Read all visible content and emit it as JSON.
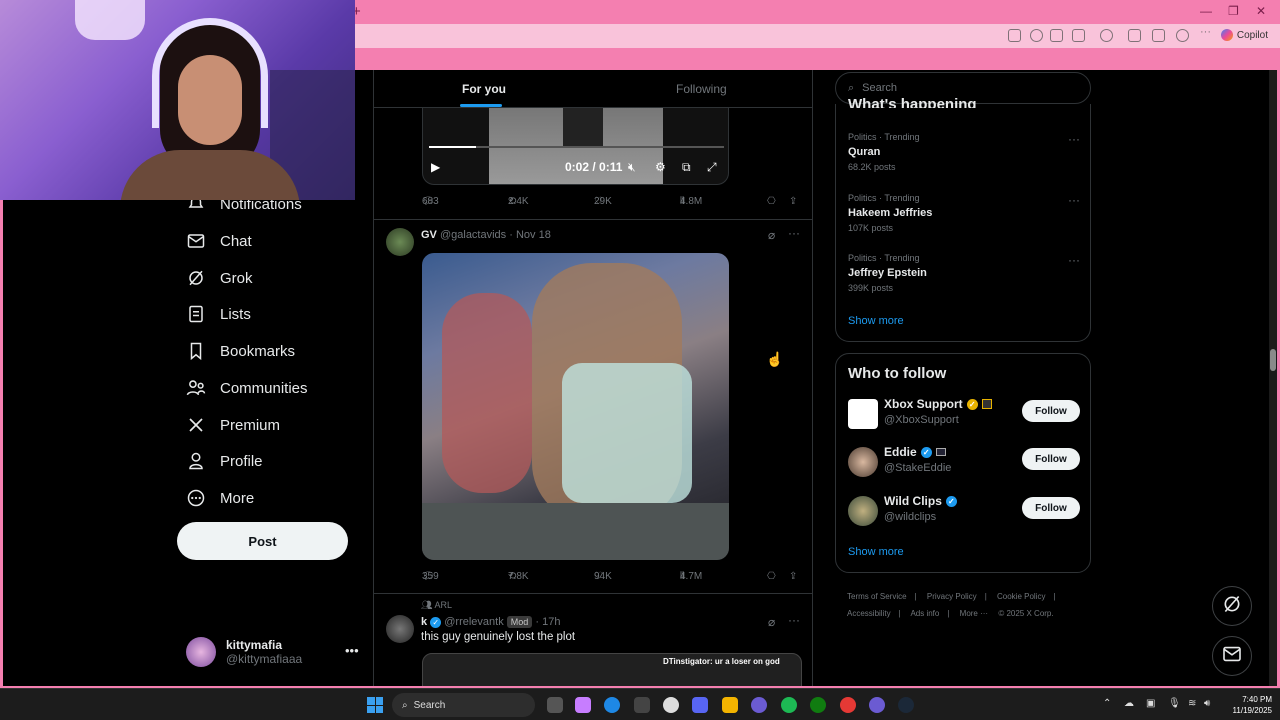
{
  "browser": {
    "new_tab": "+",
    "copilot_label": "Copilot",
    "window_controls": [
      "—",
      "❐",
      "✕"
    ]
  },
  "nav": {
    "items": [
      {
        "label": "Notifications",
        "icon": "bell-icon"
      },
      {
        "label": "Chat",
        "icon": "mail-icon"
      },
      {
        "label": "Grok",
        "icon": "grok-icon"
      },
      {
        "label": "Lists",
        "icon": "list-icon"
      },
      {
        "label": "Bookmarks",
        "icon": "bookmark-icon"
      },
      {
        "label": "Communities",
        "icon": "people-icon"
      },
      {
        "label": "Premium",
        "icon": "x-logo-icon"
      },
      {
        "label": "Profile",
        "icon": "person-icon"
      },
      {
        "label": "More",
        "icon": "more-circle-icon"
      }
    ],
    "post_label": "Post",
    "account": {
      "name": "kittymafia",
      "handle": "@kittymafiaaa"
    }
  },
  "feed": {
    "tabs": {
      "for_you": "For you",
      "following": "Following"
    },
    "video1": {
      "time": "0:02 / 0:11",
      "progress": 0.16
    },
    "tweet1_actions": {
      "replies": "683",
      "reposts": "2.4K",
      "likes": "29K",
      "views": "4.8M"
    },
    "tweet2": {
      "name": "GV",
      "handle": "@galactavids",
      "date": "· Nov 18"
    },
    "tweet2_actions": {
      "replies": "359",
      "reposts": "7.8K",
      "likes": "94K",
      "views": "4.7M"
    },
    "tweet3": {
      "community": "ARL",
      "name": "k",
      "handle": "@rrelevantk",
      "badge": "Mod",
      "date": "· 17h",
      "text": "this guy genuinely lost the plot",
      "media_caption": "DTinstigator: ur a loser on god"
    }
  },
  "sidebar": {
    "search_placeholder": "Search",
    "trends_heading": "What's happening",
    "trends": [
      {
        "category": "Politics · Trending",
        "name": "Quran",
        "count": "68.2K posts"
      },
      {
        "category": "Politics · Trending",
        "name": "Hakeem Jeffries",
        "count": "107K posts"
      },
      {
        "category": "Politics · Trending",
        "name": "Jeffrey Epstein",
        "count": "399K posts"
      }
    ],
    "show_more": "Show more",
    "who_title": "Who to follow",
    "follow": [
      {
        "name": "Xbox Support",
        "handle": "@XboxSupport",
        "button": "Follow",
        "badge_color": "#e8b300"
      },
      {
        "name": "Eddie",
        "handle": "@StakeEddie",
        "button": "Follow",
        "badge_color": "#1d9bf0"
      },
      {
        "name": "Wild Clips",
        "handle": "@wildclips",
        "button": "Follow",
        "badge_color": "#1d9bf0"
      }
    ],
    "show_more_2": "Show more",
    "footer": [
      "Terms of Service",
      "|",
      "Privacy Policy",
      "|",
      "Cookie Policy",
      "|",
      "Accessibility",
      "|",
      "Ads info",
      "|",
      "More ···",
      "© 2025 X Corp."
    ]
  },
  "taskbar": {
    "search_label": "Search",
    "time": "7:40 PM",
    "date": "11/19/2025"
  },
  "colors": {
    "accent": "#1d9bf0",
    "pink": "#f47fb0",
    "bg": "#000000"
  }
}
